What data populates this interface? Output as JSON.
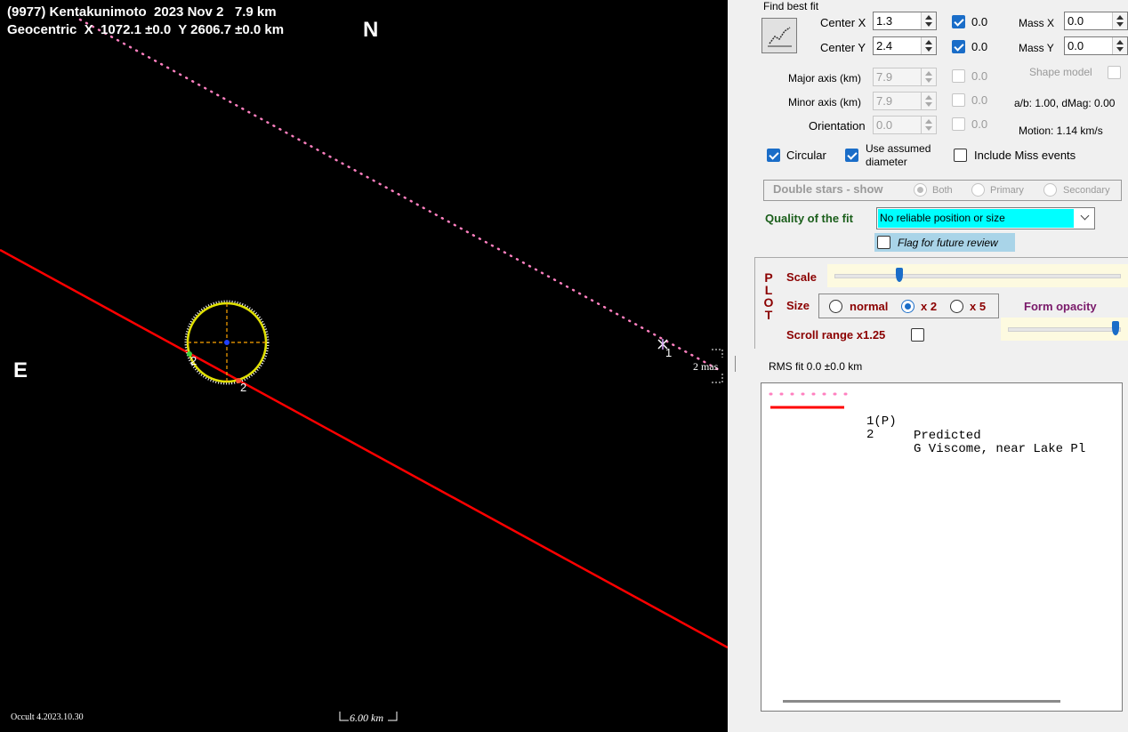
{
  "plot": {
    "title_line1": "(9977) Kentakunimoto  2023 Nov 2   7.9 km",
    "title_line2": "Geocentric  X  1072.1 ±0.0  Y 2606.7 ±0.0 km",
    "north_label": "N",
    "east_label": "E",
    "chord_labels": {
      "p1": "1",
      "c2a": "2",
      "c2b": "2"
    },
    "mas_label": "2 mas",
    "version": "Occult 4.2023.10.30",
    "scale_label": "6.00 km",
    "colors": {
      "predicted": "#ff80c0",
      "observer": "#ff0000",
      "ellipse": "#e0e000",
      "background": "#000000"
    }
  },
  "fit": {
    "heading": "Find best fit",
    "button_icon": "chart-line-icon",
    "center_x": {
      "label": "Center X",
      "value": "1.3",
      "checked": true,
      "check_label": "0.0"
    },
    "center_y": {
      "label": "Center Y",
      "value": "2.4",
      "checked": true,
      "check_label": "0.0"
    },
    "mass_x": {
      "label": "Mass X",
      "value": "0.0"
    },
    "mass_y": {
      "label": "Mass Y",
      "value": "0.0"
    },
    "shape_model": "Shape model",
    "major_axis": {
      "label": "Major axis (km)",
      "value": "7.9",
      "check_label": "0.0"
    },
    "minor_axis": {
      "label": "Minor axis (km)",
      "value": "7.9",
      "check_label": "0.0"
    },
    "orientation": {
      "label": "Orientation",
      "value": "0.0",
      "check_label": "0.0"
    },
    "ab_dmag": "a/b: 1.00, dMag: 0.00",
    "motion": "Motion: 1.14 km/s",
    "circular": {
      "label": "Circular",
      "checked": true
    },
    "use_assumed": {
      "line1": "Use assumed",
      "line2": "diameter",
      "checked": true
    },
    "include_miss": {
      "label": "Include Miss events",
      "checked": false
    },
    "double_stars": {
      "label": "Double stars - show",
      "options": [
        "Both",
        "Primary",
        "Secondary"
      ],
      "selected": "Both"
    },
    "quality": {
      "label": "Quality of the fit",
      "value": "No reliable position or size"
    },
    "flag_review": {
      "label": "Flag for future review",
      "checked": false
    }
  },
  "plotctl": {
    "letters": [
      "P",
      "L",
      "O",
      "T"
    ],
    "scale_label": "Scale",
    "scale_pos": 0.22,
    "size_label": "Size",
    "size_options": [
      "normal",
      "x 2",
      "x 5"
    ],
    "size_selected": "x 2",
    "form_opacity": "Form opacity",
    "opacity_pos": 0.98,
    "scroll_range": "Scroll range x1.25",
    "scroll_checked": false
  },
  "rms": "RMS fit 0.0 ±0.0 km",
  "legend": [
    {
      "num": "1(P)",
      "name": "Predicted",
      "style": "dotted",
      "color": "#ff80c0"
    },
    {
      "num": "2",
      "name": "G Viscome, near Lake Pl",
      "style": "solid",
      "color": "#ff0000"
    }
  ]
}
